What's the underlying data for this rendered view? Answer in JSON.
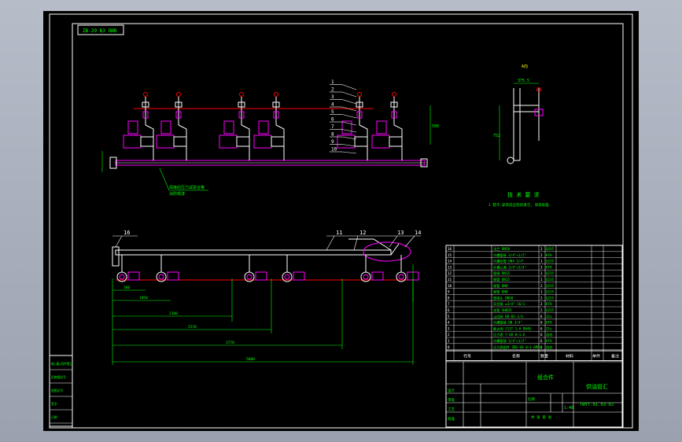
{
  "drawing": {
    "view_label": "ZB-29 ВЗ ЛИВ",
    "callouts": [
      "1",
      "2",
      "3",
      "4",
      "5",
      "6",
      "7",
      "8",
      "9",
      "10"
    ],
    "bottom_callouts": [
      "16",
      "11",
      "12",
      "13",
      "14"
    ],
    "tech_req_title": "技 术 要 求",
    "tech_req_line": "1.管子,安装前应检验清洁, 涂漆处理.",
    "dims": {
      "front_h": "500",
      "right_w": "375.5",
      "bot_1": "1050",
      "bot_2": "2100",
      "bot_3": "2570",
      "bot_4": "3770",
      "bot_5": "5000",
      "bot_small": "360"
    }
  },
  "bom": {
    "rows": [
      {
        "no": "16",
        "name": "法兰 DN50",
        "qty": "1",
        "mat": "Q235"
      },
      {
        "no": "15",
        "name": "内螺管接 3/4\"×1/2\"",
        "qty": "2",
        "mat": "KTH"
      },
      {
        "no": "14",
        "name": "内螺纹管 DN4 3/4\"",
        "qty": "1",
        "mat": "Q235"
      },
      {
        "no": "13",
        "name": "外螺三通 3/4\"×3/4\"",
        "qty": "3",
        "mat": "KTH"
      },
      {
        "no": "12",
        "name": "管接 DN15",
        "qty": "1",
        "mat": "Q235"
      },
      {
        "no": "11",
        "name": "钢管 DN15",
        "qty": "1",
        "mat": "Q235"
      },
      {
        "no": "10",
        "name": "钢管 DN8",
        "qty": "2",
        "mat": "Q235"
      },
      {
        "no": "9",
        "name": "钢管 DN8",
        "qty": "1",
        "mat": "Q235"
      },
      {
        "no": "8",
        "name": "管接头 DN50",
        "qty": "2",
        "mat": "Q235"
      },
      {
        "no": "7",
        "name": "异径接 ≥3/4\" 16/1",
        "qty": "2",
        "mat": "KTH"
      },
      {
        "no": "6",
        "name": "油管 GHB35",
        "qty": "2",
        "mat": "Q235"
      },
      {
        "no": "5",
        "name": "止回阀 RB-B3-3/4",
        "qty": "6",
        "mat": "ZCu"
      },
      {
        "no": "4",
        "name": "内螺管接 DN 3/4\"",
        "qty": "6",
        "mat": "KTH"
      },
      {
        "no": "3",
        "name": "截止阀 J11T-1.6 DN40",
        "qty": "6",
        "mat": "ZCu"
      },
      {
        "no": "2",
        "name": "压力表 Y-60 0~1.6",
        "qty": "6",
        "mat": "组合"
      },
      {
        "no": "1",
        "name": "内螺管接 3/4\"×1/2\"",
        "qty": "6",
        "mat": "KTH"
      },
      {
        "no": "0",
        "name": "压力表组件 ZBS-60 0~1.6MPa",
        "qty": "1",
        "mat": "组合"
      }
    ],
    "header": {
      "code": "代号",
      "name": "名称",
      "qty": "数量",
      "mat": "材料",
      "single": "单件",
      "total": "总计",
      "weight": "重量",
      "remark": "备注"
    }
  },
  "title_block": {
    "company": "组合件",
    "part_name": "供油管汇",
    "drawing_no": "TWYT.01.03-02",
    "ratio_label": "比例",
    "ratio": "1:40",
    "sheet": "共 张 第 张",
    "designer": "设计",
    "checker": "审核",
    "process": "工艺",
    "approve": "批准"
  },
  "left_stamp": {
    "rows": [
      "借(通)用件登记",
      "旧底图总号",
      "底图总号",
      "签字",
      "日期"
    ]
  },
  "colors": {
    "line_white": "#ffffff",
    "green": "#00ff00",
    "magenta": "#ff00ff",
    "red": "#ff0000",
    "yellow": "#ffff00",
    "cyan": "#00ffff"
  }
}
